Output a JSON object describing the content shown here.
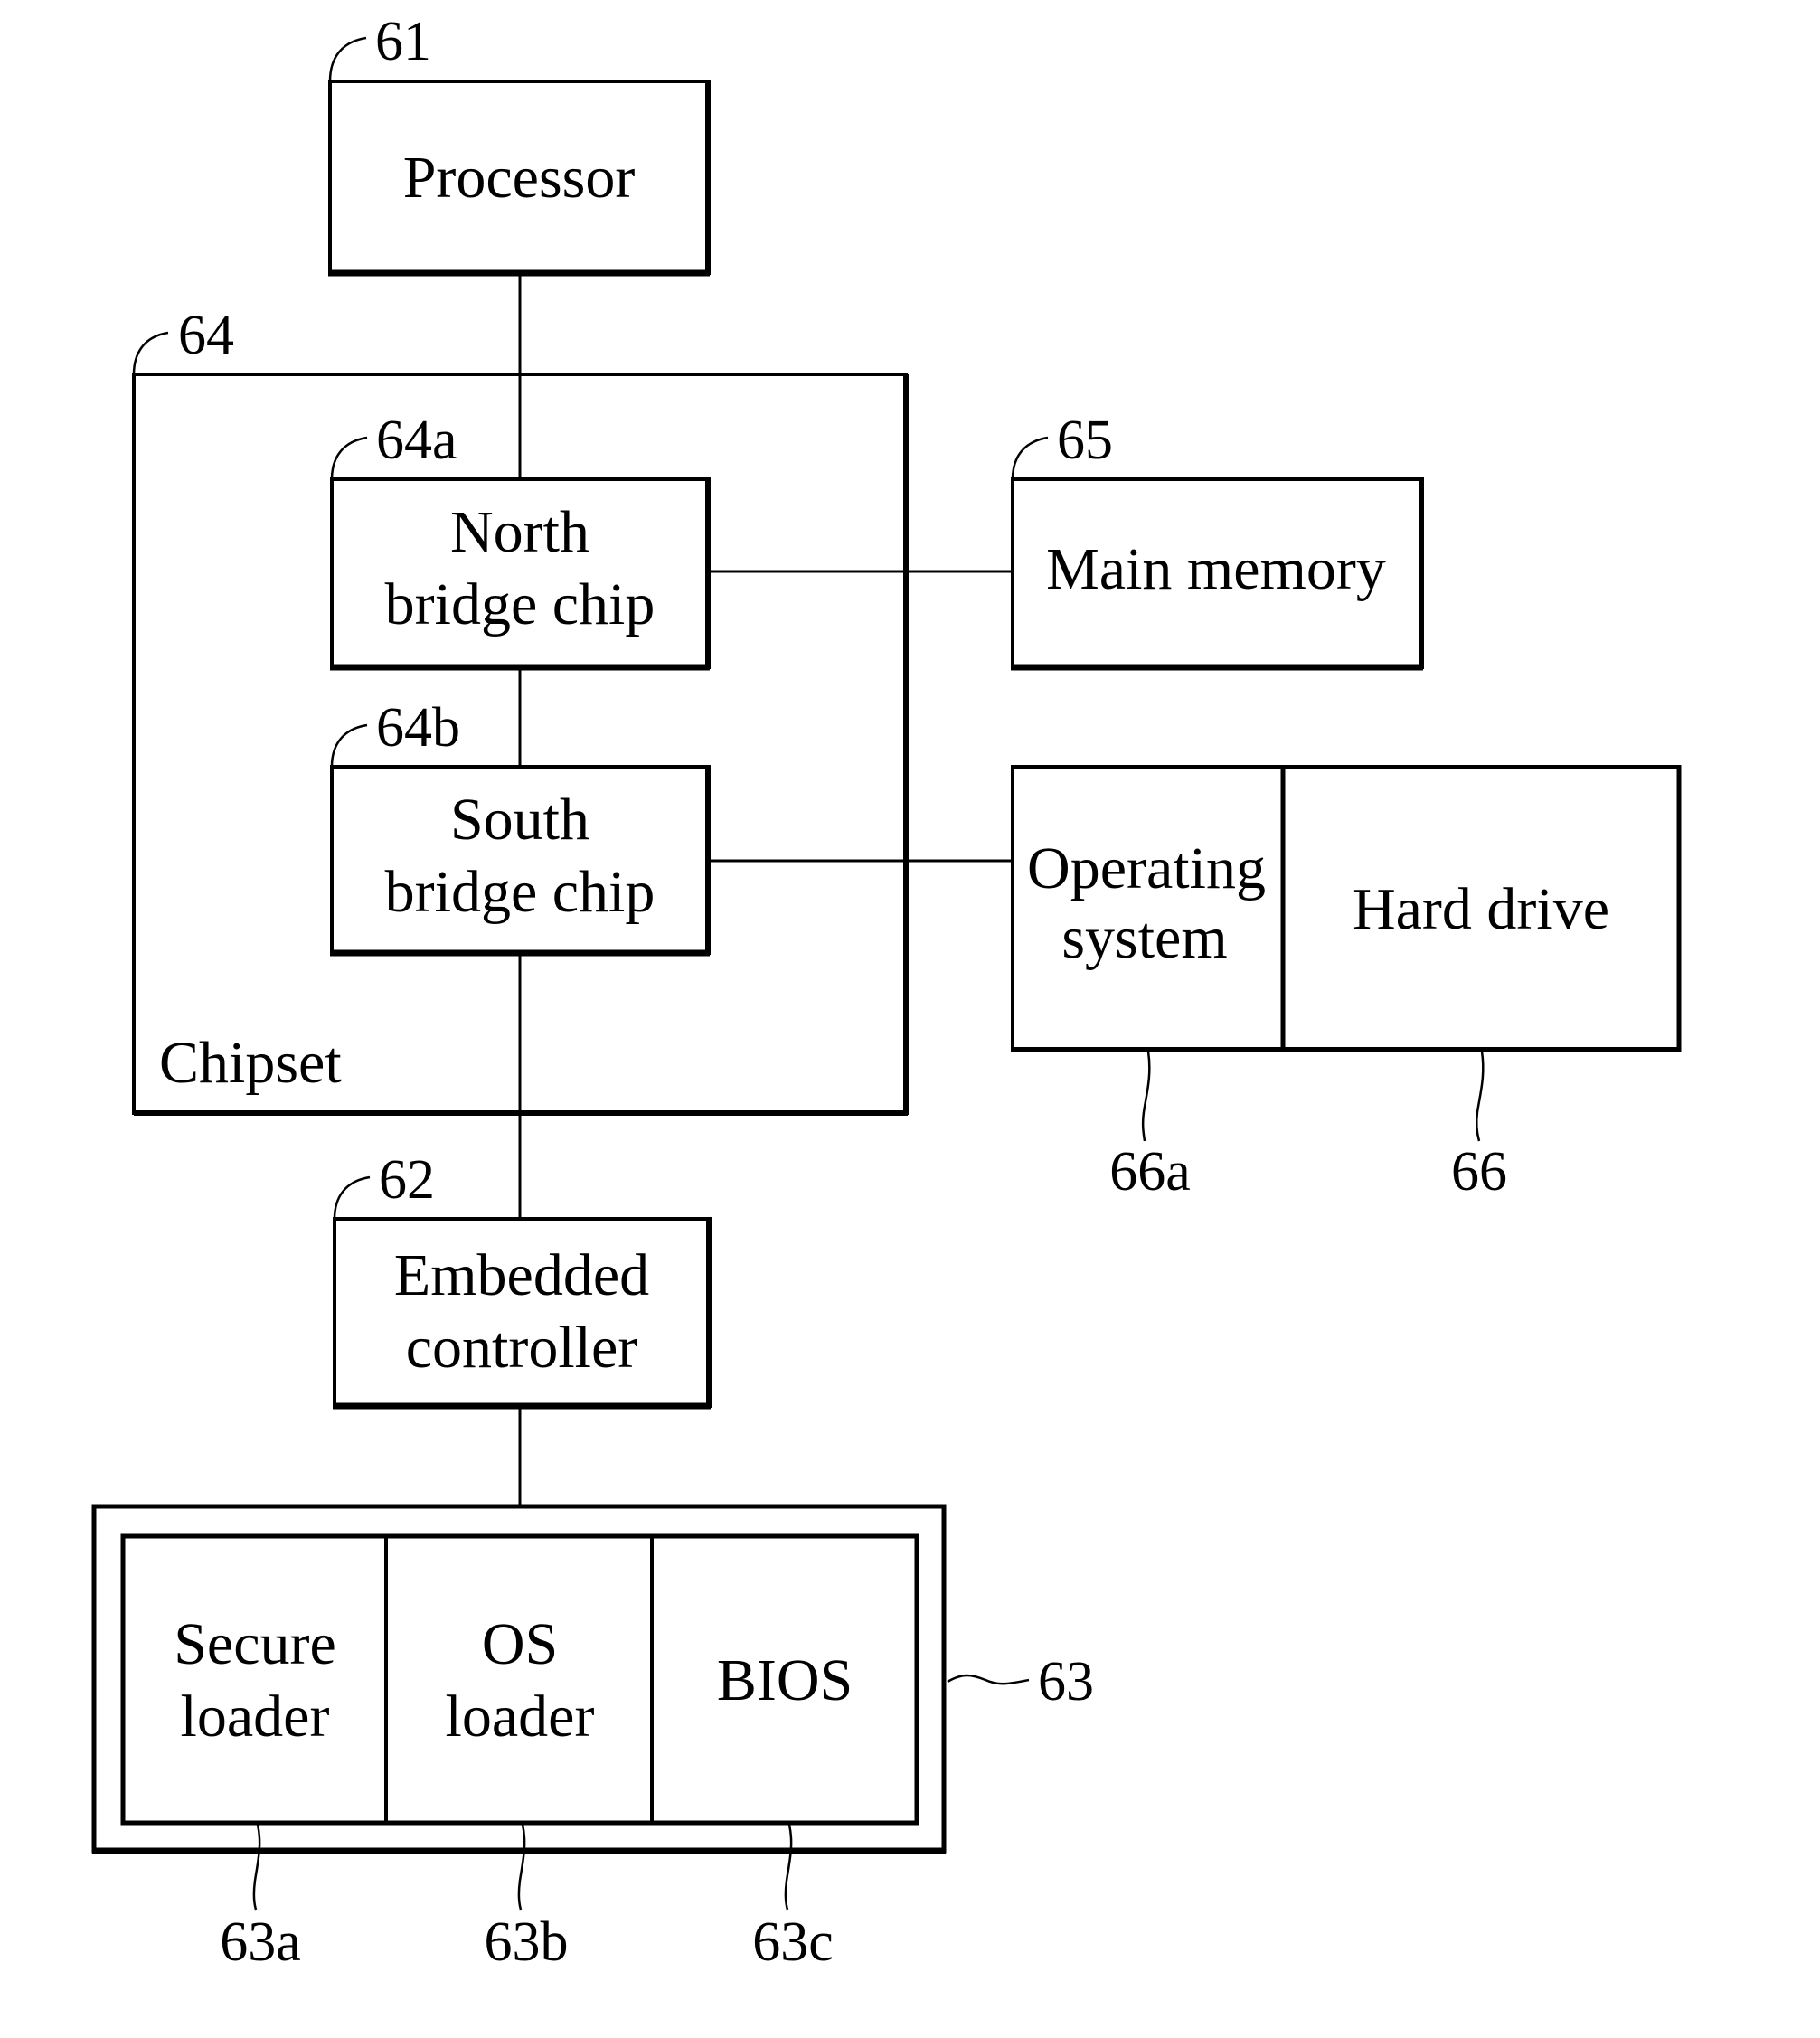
{
  "diagram": {
    "processor": {
      "ref": "61",
      "label": "Processor"
    },
    "chipset": {
      "ref": "64",
      "label": "Chipset"
    },
    "north_bridge": {
      "ref": "64a",
      "line1": "North",
      "line2": "bridge chip"
    },
    "south_bridge": {
      "ref": "64b",
      "line1": "South",
      "line2": "bridge chip"
    },
    "main_memory": {
      "ref": "65",
      "label": "Main memory"
    },
    "operating_system": {
      "ref": "66a",
      "line1": "Operating",
      "line2": "system"
    },
    "hard_drive": {
      "ref": "66",
      "label": "Hard drive"
    },
    "embedded_controller": {
      "ref": "62",
      "line1": "Embedded",
      "line2": "controller"
    },
    "firmware": {
      "ref": "63"
    },
    "secure_loader": {
      "ref": "63a",
      "line1": "Secure",
      "line2": "loader"
    },
    "os_loader": {
      "ref": "63b",
      "line1": "OS",
      "line2": "loader"
    },
    "bios": {
      "ref": "63c",
      "label": "BIOS"
    }
  }
}
